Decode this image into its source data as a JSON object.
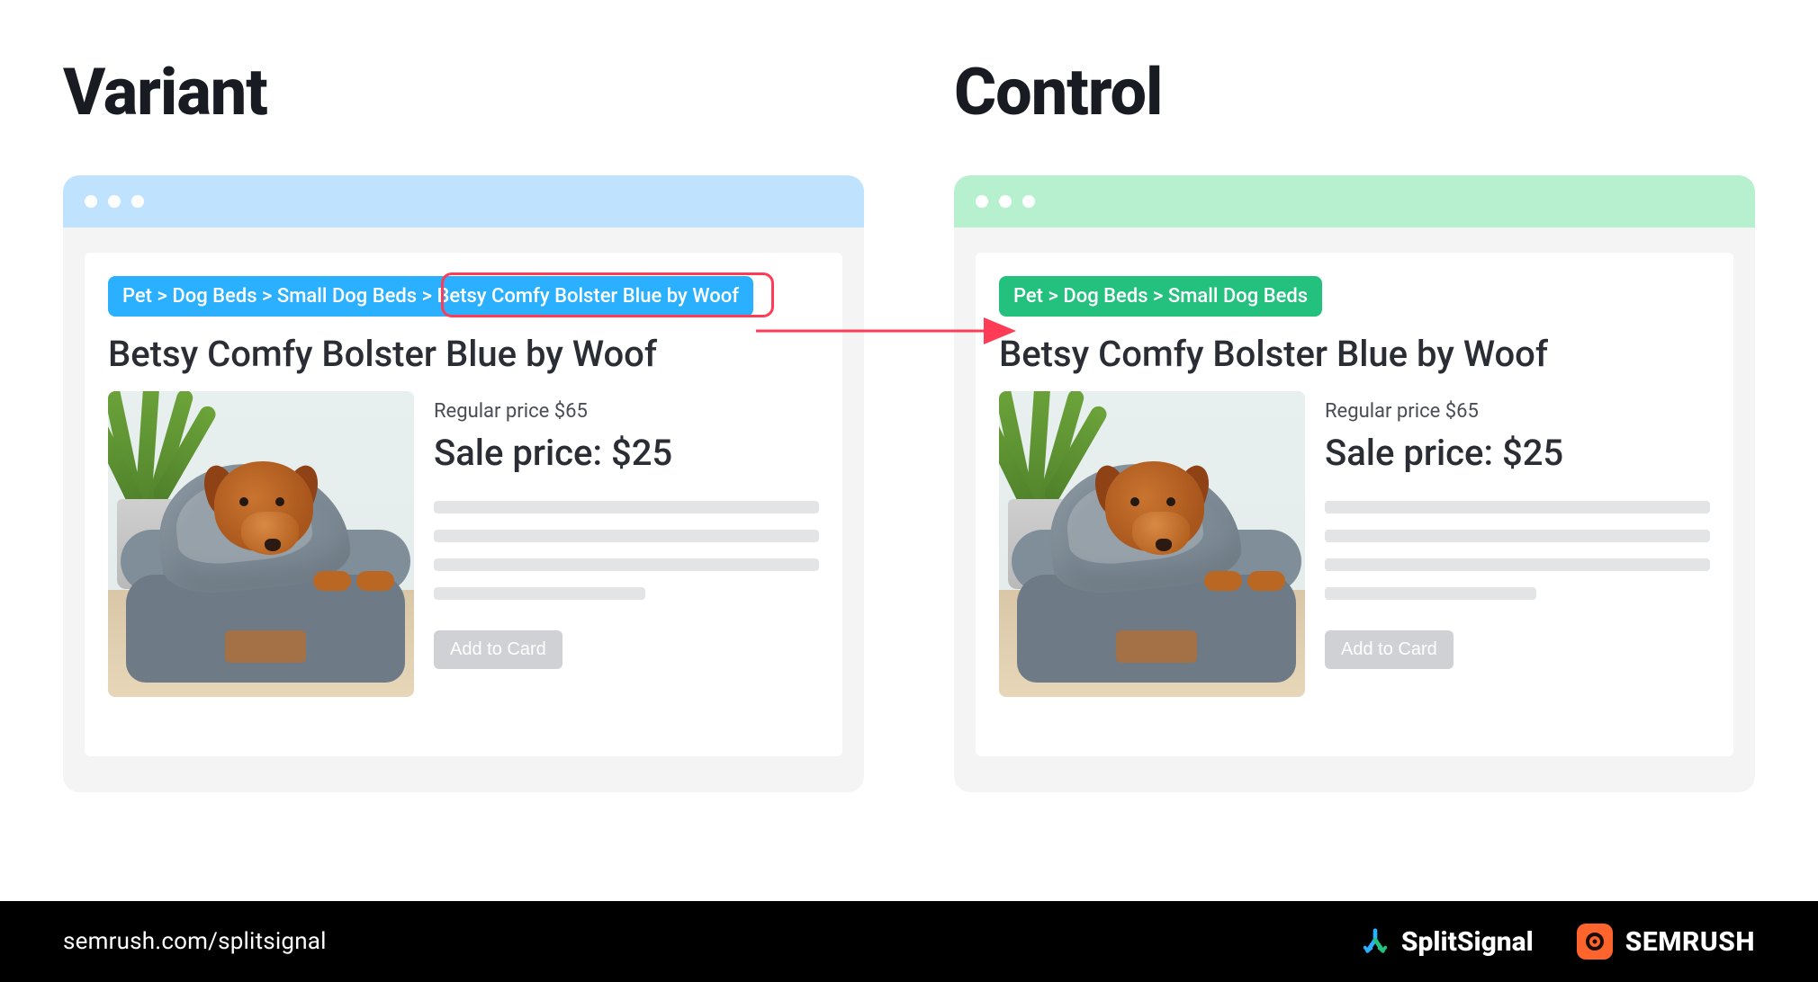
{
  "headings": {
    "variant": "Variant",
    "control": "Control"
  },
  "variant": {
    "breadcrumb_text": "Pet > Dog Beds > Small Dog Beds > Betsy Comfy Bolster Blue by Woof",
    "breadcrumb_highlight_tail": "> Betsy Comfy Bolster Blue by Woof",
    "product_title": "Betsy Comfy Bolster Blue by Woof",
    "regular_price": "Regular price $65",
    "sale_price": "Sale price: $25",
    "add_to_cart": "Add to Card",
    "colors": {
      "topbar": "#bfe3ff",
      "crumb": "#2bb0ff"
    }
  },
  "control": {
    "breadcrumb_text": "Pet > Dog Beds > Small Dog Beds",
    "product_title": "Betsy Comfy Bolster Blue by Woof",
    "regular_price": "Regular price $65",
    "sale_price": "Sale price: $25",
    "add_to_cart": "Add to Card",
    "colors": {
      "topbar": "#b7f0cf",
      "crumb": "#23c07e"
    }
  },
  "footer": {
    "url": "semrush.com/splitsignal",
    "brand1": "SplitSignal",
    "brand2": "SEMRUSH"
  }
}
